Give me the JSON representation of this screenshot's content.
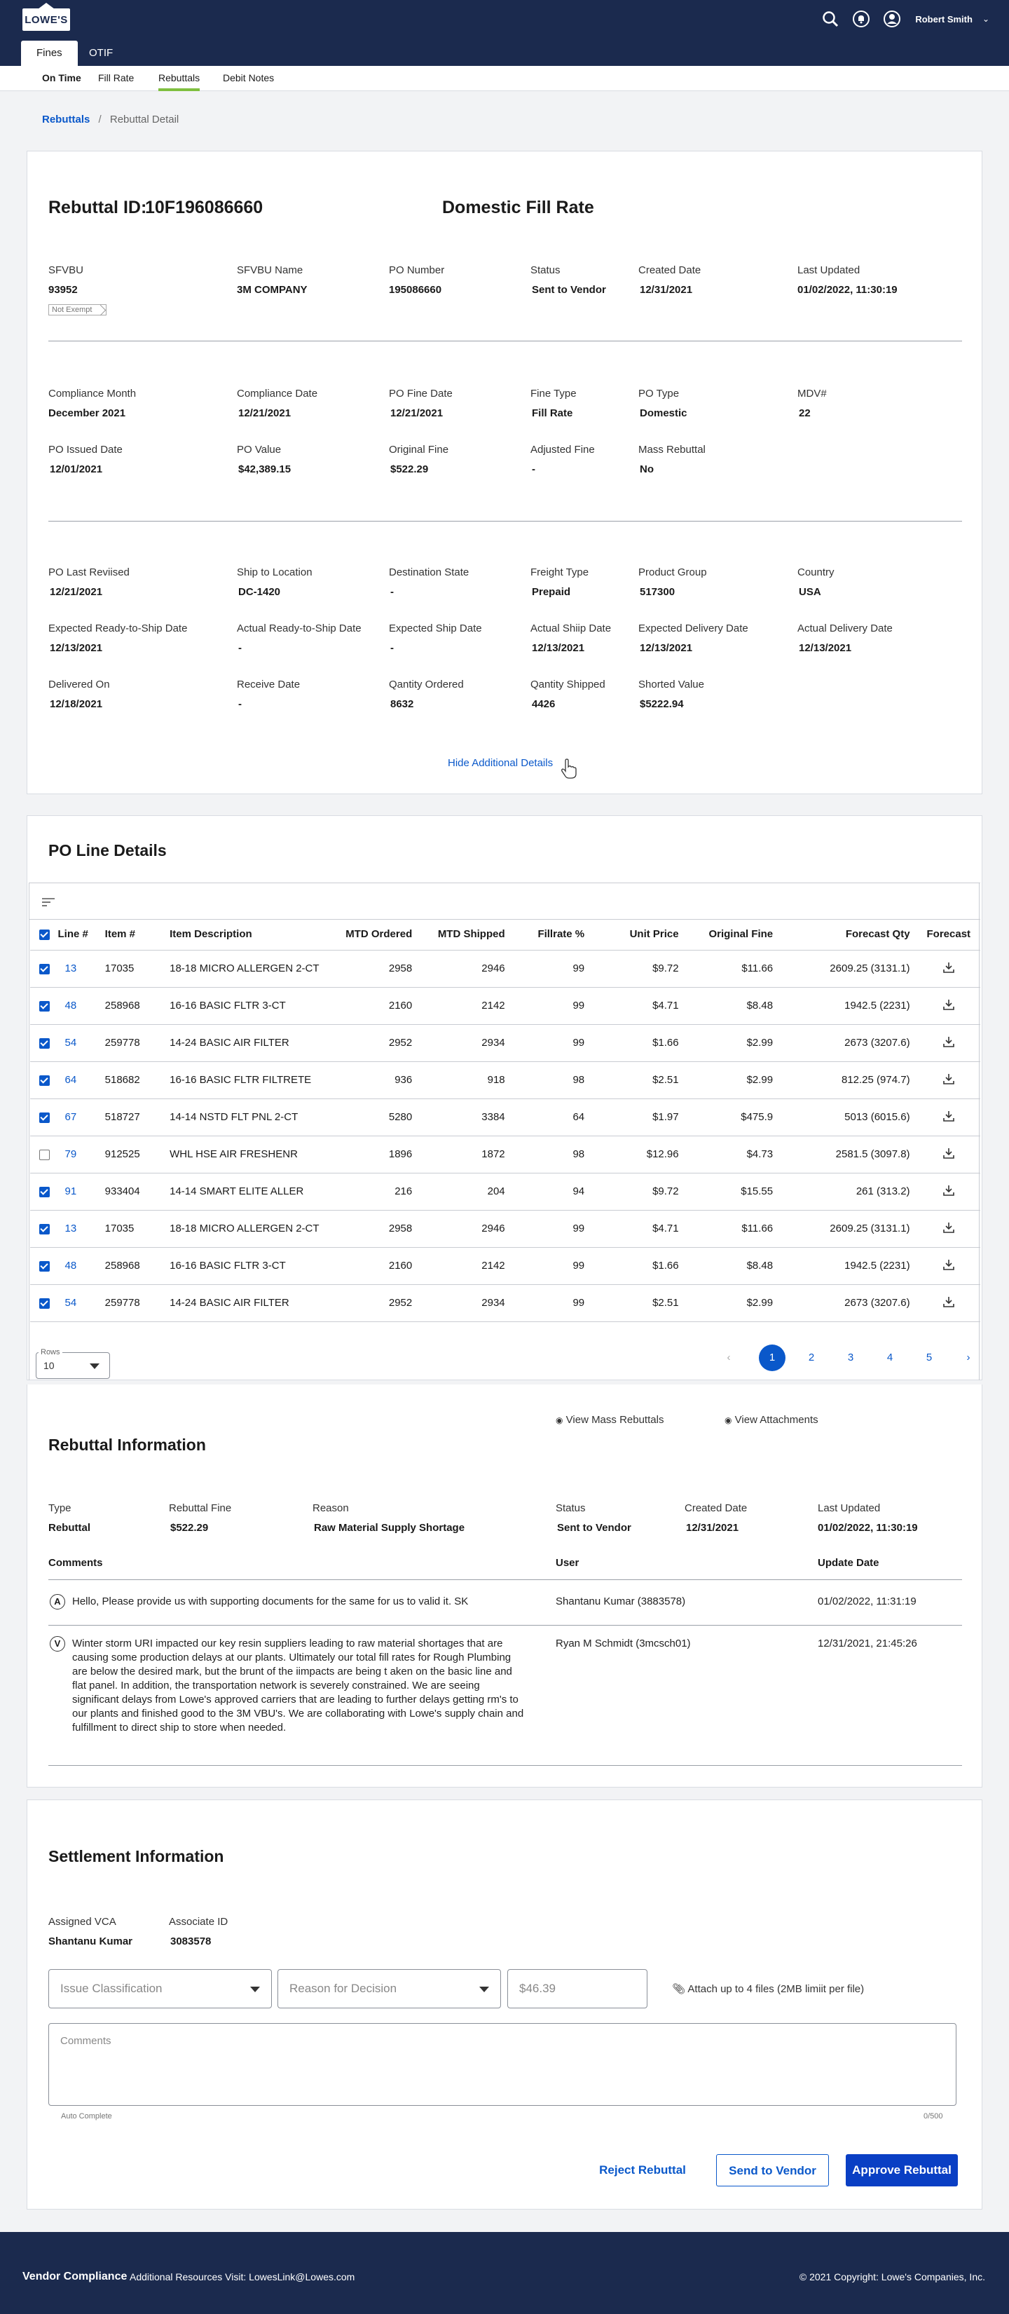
{
  "header": {
    "logo_text": "LOWE'S",
    "user_name": "Robert Smith",
    "icons": [
      "search-icon",
      "notification-icon",
      "user-icon",
      "chevron-down-icon"
    ]
  },
  "tabs": [
    {
      "label": "Fines",
      "active": true
    },
    {
      "label": "OTIF",
      "active": false
    }
  ],
  "subnav": [
    {
      "label": "On Time",
      "bold": true,
      "selected": false
    },
    {
      "label": "Fill Rate",
      "bold": false,
      "selected": false
    },
    {
      "label": "Rebuttals",
      "bold": false,
      "selected": true
    },
    {
      "label": "Debit Notes",
      "bold": false,
      "selected": false
    }
  ],
  "breadcrumb": {
    "link": "Rebuttals",
    "separator": "/",
    "current": "Rebuttal Detail"
  },
  "rebuttal": {
    "id_label": "Rebuttal ID:",
    "id_value": "10F196086660",
    "type_title": "Domestic Fill Rate",
    "badge": "Not Exempt",
    "fields_row1": [
      {
        "label": "SFVBU",
        "value": "93952"
      },
      {
        "label": "SFVBU Name",
        "value": "3M COMPANY"
      },
      {
        "label": "PO Number",
        "value": "195086660"
      },
      {
        "label": "Status",
        "value": "Sent to Vendor"
      },
      {
        "label": "Created Date",
        "value": "12/31/2021"
      },
      {
        "label": "Last Updated",
        "value": "01/02/2022, 11:30:19"
      }
    ],
    "fields_row2": [
      {
        "label": "Compliance Month",
        "value": "December 2021"
      },
      {
        "label": "Compliance Date",
        "value": "12/21/2021"
      },
      {
        "label": "PO Fine Date",
        "value": "12/21/2021"
      },
      {
        "label": "Fine Type",
        "value": "Fill Rate"
      },
      {
        "label": "PO Type",
        "value": "Domestic"
      },
      {
        "label": "MDV#",
        "value": "22"
      }
    ],
    "fields_row3": [
      {
        "label": "PO Issued Date",
        "value": "12/01/2021"
      },
      {
        "label": "PO Value",
        "value": "$42,389.15"
      },
      {
        "label": "Original Fine",
        "value": "$522.29"
      },
      {
        "label": "Adjusted Fine",
        "value": "-"
      },
      {
        "label": "Mass Rebuttal",
        "value": "No"
      }
    ],
    "fields_row4": [
      {
        "label": "PO Last Reviised",
        "value": "12/21/2021"
      },
      {
        "label": "Ship to Location",
        "value": "DC-1420"
      },
      {
        "label": "Destination State",
        "value": "-"
      },
      {
        "label": "Freight Type",
        "value": "Prepaid"
      },
      {
        "label": "Product Group",
        "value": "517300"
      },
      {
        "label": "Country",
        "value": "USA"
      }
    ],
    "fields_row5": [
      {
        "label": "Expected Ready-to-Ship Date",
        "value": "12/13/2021"
      },
      {
        "label": "Actual Ready-to-Ship Date",
        "value": "-"
      },
      {
        "label": "Expected Ship Date",
        "value": "-"
      },
      {
        "label": "Actual Shiip Date",
        "value": "12/13/2021"
      },
      {
        "label": "Expected Delivery Date",
        "value": "12/13/2021"
      },
      {
        "label": "Actual Delivery Date",
        "value": "12/13/2021"
      }
    ],
    "fields_row6": [
      {
        "label": "Delivered On",
        "value": "12/18/2021"
      },
      {
        "label": "Receive Date",
        "value": "-"
      },
      {
        "label": "Qantity Ordered",
        "value": "8632"
      },
      {
        "label": "Qantity Shipped",
        "value": "4426"
      },
      {
        "label": "Shorted Value",
        "value": "$5222.94"
      }
    ],
    "hide_details_label": "Hide Additional Details"
  },
  "po_lines": {
    "title": "PO Line Details",
    "columns": [
      "Line #",
      "Item #",
      "Item Description",
      "MTD Ordered",
      "MTD Shipped",
      "Fillrate %",
      "Unit Price",
      "Original Fine",
      "Forecast Qty",
      "Forecast"
    ],
    "rows": [
      {
        "checked": true,
        "line": "13",
        "item": "17035",
        "desc": "18-18 MICRO ALLERGEN 2-CT",
        "ordered": "2958",
        "shipped": "2946",
        "fillrate": "99",
        "price": "$9.72",
        "fine": "$11.66",
        "forecast_qty": "2609.25 (3131.1)"
      },
      {
        "checked": true,
        "line": "48",
        "item": "258968",
        "desc": "16-16 BASIC FLTR 3-CT",
        "ordered": "2160",
        "shipped": "2142",
        "fillrate": "99",
        "price": "$4.71",
        "fine": "$8.48",
        "forecast_qty": "1942.5 (2231)"
      },
      {
        "checked": true,
        "line": "54",
        "item": "259778",
        "desc": "14-24 BASIC AIR FILTER",
        "ordered": "2952",
        "shipped": "2934",
        "fillrate": "99",
        "price": "$1.66",
        "fine": "$2.99",
        "forecast_qty": "2673 (3207.6)"
      },
      {
        "checked": true,
        "line": "64",
        "item": "518682",
        "desc": "16-16 BASIC FLTR FILTRETE",
        "ordered": "936",
        "shipped": "918",
        "fillrate": "98",
        "price": "$2.51",
        "fine": "$2.99",
        "forecast_qty": "812.25 (974.7)"
      },
      {
        "checked": true,
        "line": "67",
        "item": "518727",
        "desc": "14-14 NSTD FLT PNL 2-CT",
        "ordered": "5280",
        "shipped": "3384",
        "fillrate": "64",
        "price": "$1.97",
        "fine": "$475.9",
        "forecast_qty": "5013 (6015.6)"
      },
      {
        "checked": false,
        "line": "79",
        "item": "912525",
        "desc": "WHL HSE AIR FRESHENR",
        "ordered": "1896",
        "shipped": "1872",
        "fillrate": "98",
        "price": "$12.96",
        "fine": "$4.73",
        "forecast_qty": "2581.5 (3097.8)"
      },
      {
        "checked": true,
        "line": "91",
        "item": "933404",
        "desc": "14-14 SMART ELITE ALLER",
        "ordered": "216",
        "shipped": "204",
        "fillrate": "94",
        "price": "$9.72",
        "fine": "$15.55",
        "forecast_qty": "261 (313.2)"
      },
      {
        "checked": true,
        "line": "13",
        "item": "17035",
        "desc": "18-18 MICRO ALLERGEN 2-CT",
        "ordered": "2958",
        "shipped": "2946",
        "fillrate": "99",
        "price": "$4.71",
        "fine": "$11.66",
        "forecast_qty": "2609.25 (3131.1)"
      },
      {
        "checked": true,
        "line": "48",
        "item": "258968",
        "desc": "16-16 BASIC FLTR 3-CT",
        "ordered": "2160",
        "shipped": "2142",
        "fillrate": "99",
        "price": "$1.66",
        "fine": "$8.48",
        "forecast_qty": "1942.5 (2231)"
      },
      {
        "checked": true,
        "line": "54",
        "item": "259778",
        "desc": "14-24 BASIC AIR FILTER",
        "ordered": "2952",
        "shipped": "2934",
        "fillrate": "99",
        "price": "$2.51",
        "fine": "$2.99",
        "forecast_qty": "2673 (3207.6)"
      }
    ],
    "rows_label": "Rows",
    "rows_value": "10",
    "pages": [
      "1",
      "2",
      "3",
      "4",
      "5"
    ],
    "active_page": "1"
  },
  "rebuttal_info": {
    "title": "Rebuttal Information",
    "view_mass": "View Mass Rebuttals",
    "view_attachments": "View Attachments",
    "fields": [
      {
        "label": "Type",
        "value": "Rebuttal"
      },
      {
        "label": "Rebuttal Fine",
        "value": "$522.29"
      },
      {
        "label": "Reason",
        "value": "Raw Material Supply Shortage"
      },
      {
        "label": "Status",
        "value": "Sent to Vendor"
      },
      {
        "label": "Created Date",
        "value": "12/31/2021"
      },
      {
        "label": "Last Updated",
        "value": "01/02/2022, 11:30:19"
      }
    ],
    "comment_headers": {
      "comments": "Comments",
      "user": "User",
      "date": "Update Date"
    },
    "comments": [
      {
        "avatar": "A",
        "text": "Hello, Please provide us with supporting documents for the same for us to valid it.  SK",
        "user": "Shantanu Kumar (3883578)",
        "date": "01/02/2022, 11:31:19"
      },
      {
        "avatar": "V",
        "text": "Winter storm URI impacted our key resin suppliers leading to raw material shortages that are causing some production delays at our plants.  Ultimately our total fill rates for Rough Plumbing are below the desired mark, but the brunt of the iimpacts are being t aken on the basic line and flat panel.  In addition, the transportation network is severely constrained.  We are seeing significant delays from Lowe's approved carriers that are leading to further delays getting rm's to our plants and finished good to the 3M VBU's.  We are collaborating with Lowe's supply chain and fulfillment to direct ship to store when needed.",
        "user": "Ryan M Schmidt (3mcsch01)",
        "date": "12/31/2021, 21:45:26"
      }
    ]
  },
  "settlement": {
    "title": "Settlement Information",
    "assigned_vca_label": "Assigned VCA",
    "assigned_vca_value": "Shantanu Kumar",
    "associate_id_label": "Associate ID",
    "associate_id_value": "3083578",
    "issue_placeholder": "Issue Classification",
    "reason_placeholder": "Reason for Decision",
    "amount_placeholder": "$46.39",
    "attach_label": "Attach up to 4 files (2MB limiit per file)",
    "comments_placeholder": "Comments",
    "auto_complete": "Auto Complete",
    "char_count": "0/500",
    "reject_label": "Reject Rebuttal",
    "send_label": "Send to Vendor",
    "approve_label": "Approve Rebuttal"
  },
  "footer": {
    "brand": "Vendor Compliance",
    "resources": "Additional Resources Visit: LowesLink@Lowes.com",
    "copyright": "© 2021 Copyright: Lowe's Companies, Inc."
  },
  "colors": {
    "navy": "#1b2a4e",
    "link": "#0a58ca",
    "primary_button": "#0a3fc4",
    "tab_underline": "#7fbf3f"
  }
}
